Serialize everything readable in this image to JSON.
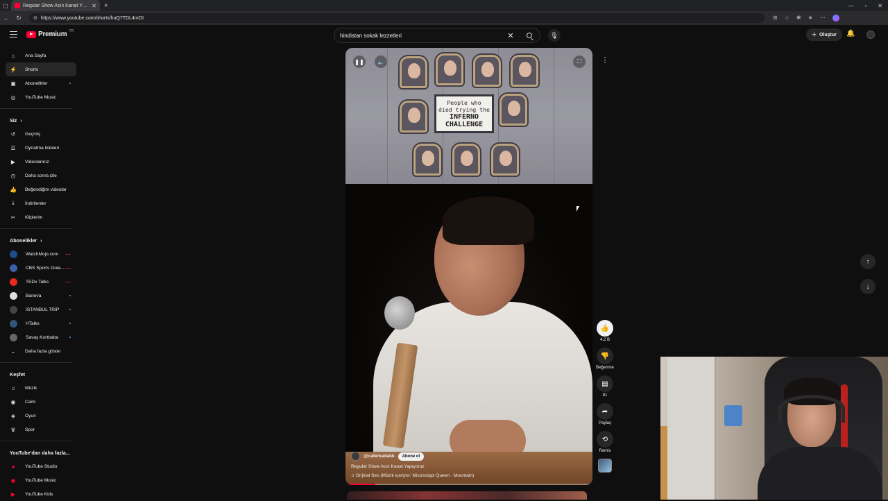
{
  "browser": {
    "tab_title": "Regular Show Acılı Kanat Yapıyoruz",
    "url": "https://www.youtube.com/shorts/huQ7TDL4mOI",
    "new_tab_symbol": "+"
  },
  "header": {
    "logo_text": "Premium",
    "logo_sup": "TR",
    "search_query": "hindistan sokak lezzetleri",
    "create_label": "Oluştur"
  },
  "sidebar": {
    "main": [
      {
        "label": "Ana Sayfa",
        "icon": "home-icon",
        "glyph": "⌂"
      },
      {
        "label": "Shorts",
        "icon": "shorts-icon",
        "glyph": "⚡"
      },
      {
        "label": "Abonelikler",
        "icon": "subscriptions-icon",
        "glyph": "▣"
      },
      {
        "label": "YouTube Music",
        "icon": "music-circle-icon",
        "glyph": "◎"
      }
    ],
    "you_heading": "Siz",
    "you": [
      {
        "label": "Geçmiş",
        "icon": "history-icon",
        "glyph": "↺"
      },
      {
        "label": "Oynatma listeleri",
        "icon": "playlists-icon",
        "glyph": "☰"
      },
      {
        "label": "Videolarınız",
        "icon": "your-videos-icon",
        "glyph": "▶"
      },
      {
        "label": "Daha sonra izle",
        "icon": "watch-later-icon",
        "glyph": "◷"
      },
      {
        "label": "Beğendiğim videolar",
        "icon": "liked-icon",
        "glyph": "👍"
      },
      {
        "label": "İndirilenler",
        "icon": "download-icon",
        "glyph": "⤓"
      },
      {
        "label": "Kliplerim",
        "icon": "clips-icon",
        "glyph": "✂"
      }
    ],
    "subs_heading": "Abonelikler",
    "subs": [
      {
        "label": "WatchMojo.com",
        "color": "#1d4e89"
      },
      {
        "label": "CBS Sports Gola...",
        "color": "#3d5fa8"
      },
      {
        "label": "TEDx Talks",
        "color": "#e62b1e"
      },
      {
        "label": "Baneva",
        "color": "#dddddd"
      },
      {
        "label": "ISTANBUL TRIP",
        "color": "#444444"
      },
      {
        "label": "HTalks",
        "color": "#335577"
      },
      {
        "label": "Savaş Kurtbaba",
        "color": "#666666"
      }
    ],
    "show_more": "Daha fazla göster",
    "explore_heading": "Keşfet",
    "explore": [
      {
        "label": "Müzik",
        "icon": "music-note-icon",
        "glyph": "♫"
      },
      {
        "label": "Canlı",
        "icon": "live-icon",
        "glyph": "◉"
      },
      {
        "label": "Oyun",
        "icon": "gaming-icon",
        "glyph": "◈"
      },
      {
        "label": "Spor",
        "icon": "trophy-icon",
        "glyph": "♛"
      }
    ],
    "more_heading": "YouTube'dan daha fazla...",
    "more": [
      {
        "label": "YouTube Studio"
      },
      {
        "label": "YouTube Music"
      },
      {
        "label": "YouTube Kids"
      }
    ]
  },
  "short": {
    "sign_line1": "People who",
    "sign_line2": "died trying the",
    "sign_line3": "INFERNO",
    "sign_line4": "CHALLENGE",
    "channel": "@caferkadakk",
    "subscribe_label": "Abone ol",
    "title": "Regular Show Acılı Kanat Yapıyoruz",
    "sound": "♫ Orijinal Ses (Müzik içeriyor: Mississippi Queen · Mountain)",
    "progress": 0.12
  },
  "actions": {
    "likes": "4,2 B",
    "dislike_label": "Beğenme",
    "comments": "81",
    "share_label": "Paylaş",
    "remix_label": "Remix"
  },
  "colors": {
    "accent": "#ff0033",
    "background": "#0f0f0f"
  }
}
